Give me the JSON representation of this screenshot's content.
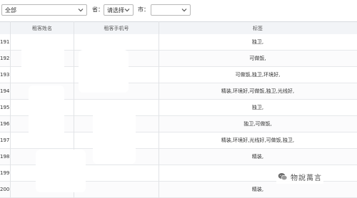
{
  "filters": {
    "category_value": "全部",
    "province_label": "省：",
    "province_value": "请选择",
    "city_label": "市："
  },
  "table": {
    "headers": [
      "租客姓名",
      "租客手机号",
      "标签"
    ],
    "rows": [
      {
        "id": "191",
        "tags": "独卫,"
      },
      {
        "id": "192",
        "tags": "可做饭,"
      },
      {
        "id": "193",
        "tags": "可做饭,独卫,环境好,"
      },
      {
        "id": "194",
        "tags": "精装,环境好,可做饭,独卫,光线好,"
      },
      {
        "id": "195",
        "tags": "独卫,"
      },
      {
        "id": "196",
        "tags": "独卫,可做饭,"
      },
      {
        "id": "197",
        "tags": "精装,环境好,光线好,可做饭,独卫,"
      },
      {
        "id": "198",
        "tags": "精装,"
      },
      {
        "id": "199",
        "tags": ""
      },
      {
        "id": "200",
        "tags": "精装,"
      }
    ]
  },
  "watermark": {
    "text": "物說萬言",
    "icon": "wechat-icon"
  }
}
